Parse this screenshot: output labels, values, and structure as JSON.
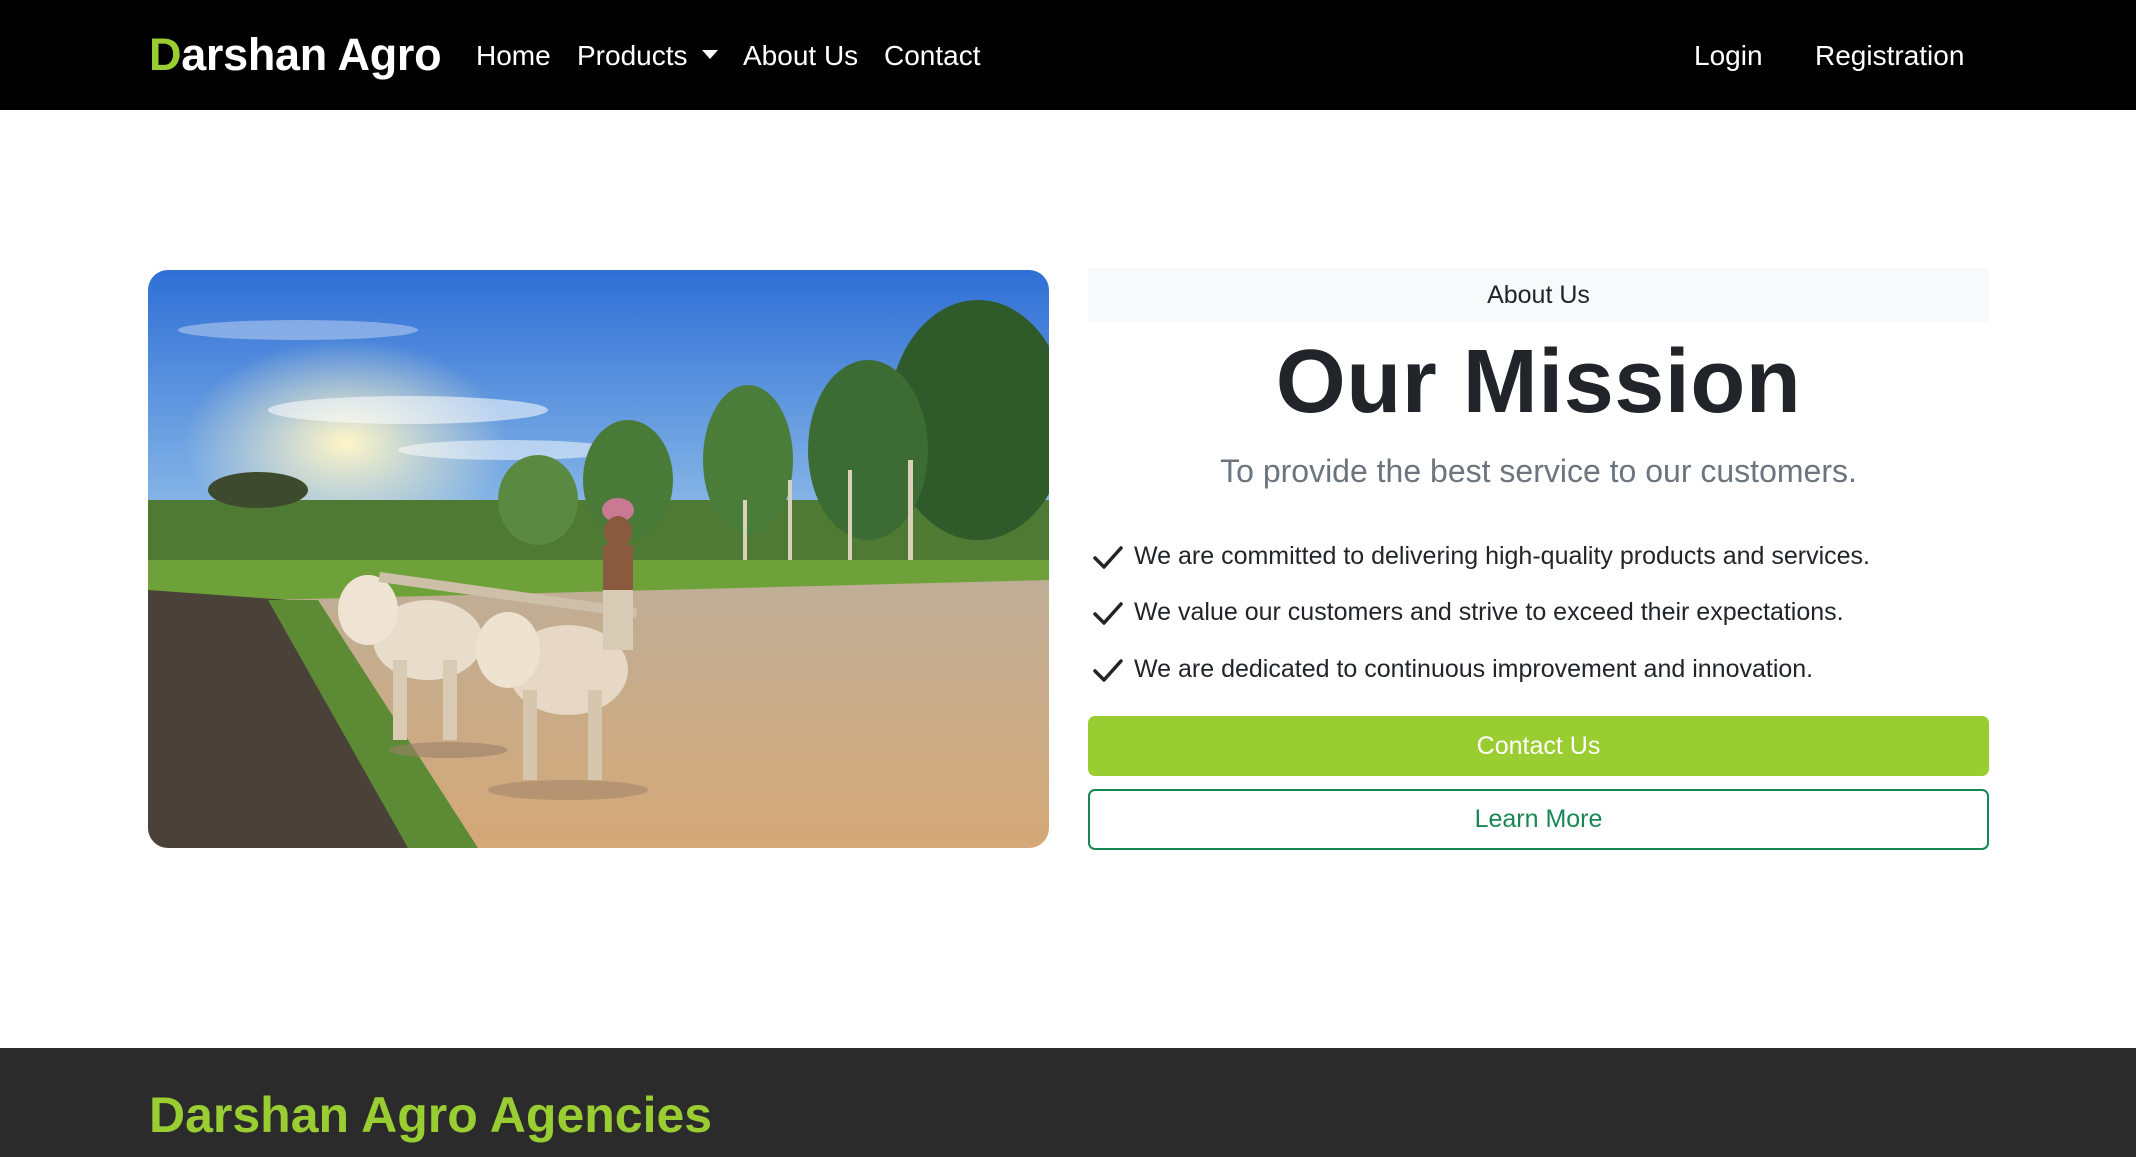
{
  "navbar": {
    "brand_first": "D",
    "brand_rest": "arshan Agro",
    "links": {
      "home": "Home",
      "products": "Products",
      "about": "About Us",
      "contact": "Contact",
      "login": "Login",
      "registration": "Registration"
    }
  },
  "hero": {
    "image_alt": "farmer-plowing-field-with-oxen-image",
    "section_label": "About Us",
    "title": "Our Mission",
    "lead": "To provide the best service to our customers.",
    "features": [
      "We are committed to delivering high-quality products and services.",
      "We value our customers and strive to exceed their expectations.",
      "We are dedicated to continuous improvement and innovation."
    ],
    "primary_button": "Contact Us",
    "secondary_button": "Learn More"
  },
  "footer": {
    "title": "Darshan Agro Agencies"
  },
  "colors": {
    "navbar_bg": "#000000",
    "brand_accent": "#9acd32",
    "primary_button": "#9acd32",
    "outline_button": "#198754",
    "footer_bg": "#2b2b2b",
    "label_bg": "#f8f9fa"
  },
  "icons": {
    "feature_icon": "check-icon",
    "dropdown_icon": "caret-down-icon"
  }
}
